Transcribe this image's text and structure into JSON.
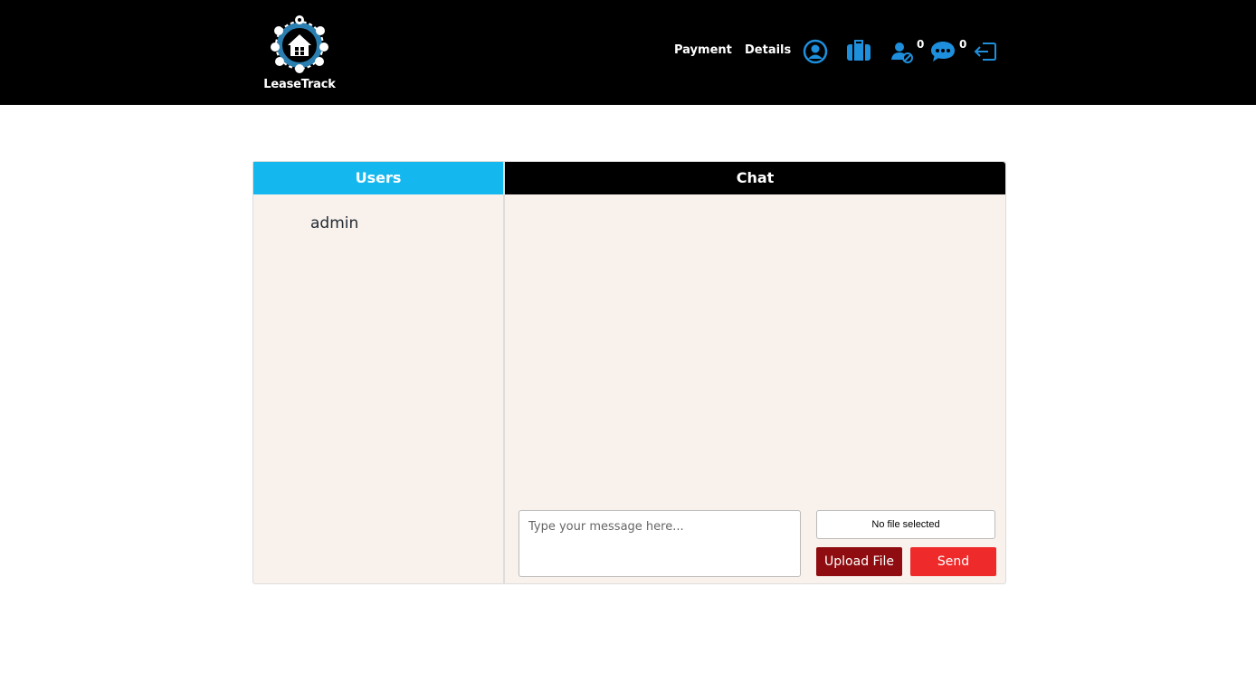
{
  "header": {
    "logo_text": "LeaseTrack",
    "nav": {
      "payment_label": "Payment",
      "details_label": "Details"
    },
    "icons": {
      "profile": "user-circle-icon",
      "briefcase": "briefcase-icon",
      "user_requests": "user-block-icon",
      "messages": "chat-bubble-icon",
      "logout": "logout-icon"
    },
    "badges": {
      "user_requests_count": "0",
      "messages_count": "0"
    },
    "accent_color": "#1e8fdc"
  },
  "users_panel": {
    "title": "Users",
    "users": [
      {
        "name": "admin"
      }
    ],
    "header_color": "#15b8ee"
  },
  "chat_panel": {
    "title": "Chat",
    "message_placeholder": "Type your message here...",
    "file_status": "No file selected",
    "upload_label": "Upload File",
    "send_label": "Send",
    "upload_color": "#8f0d10",
    "send_color": "#ee2a2a"
  }
}
